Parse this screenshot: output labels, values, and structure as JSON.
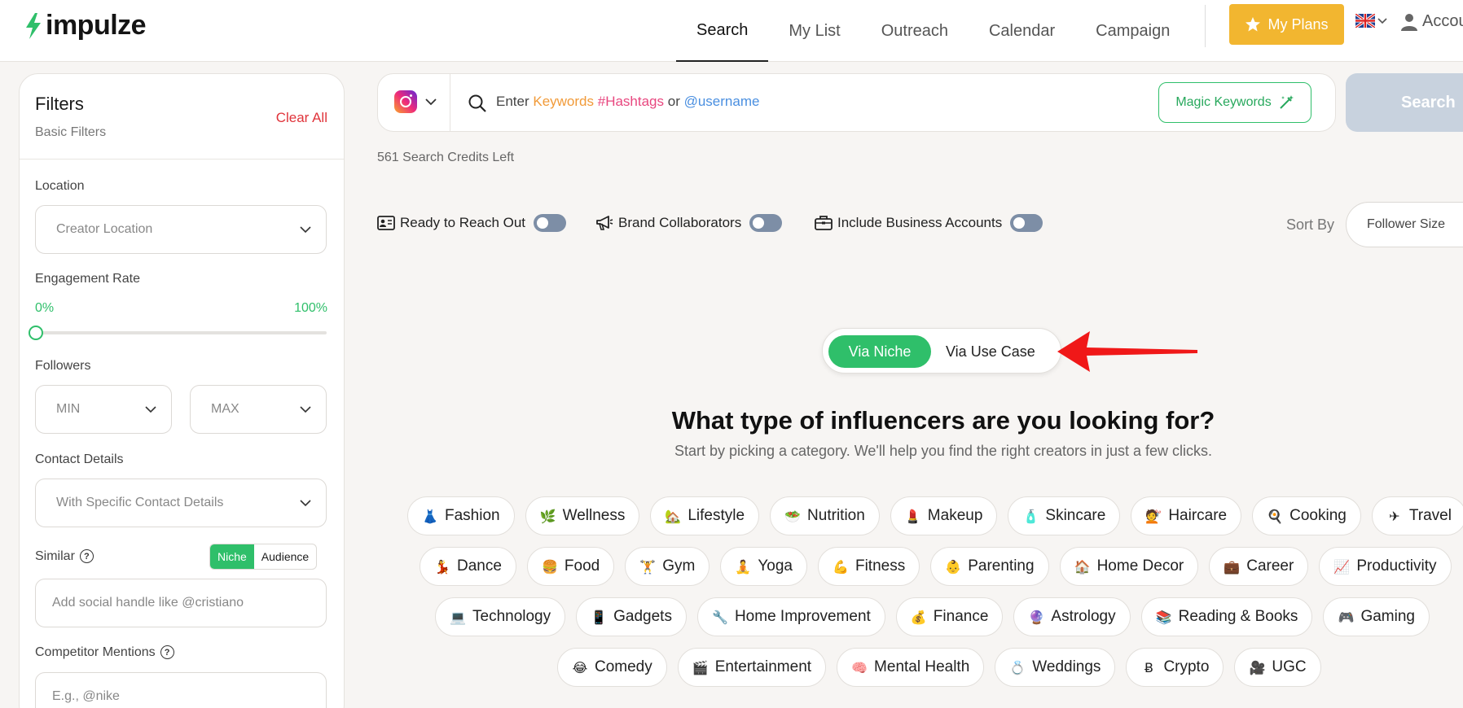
{
  "header": {
    "logo_text": "impulze",
    "nav": [
      "Search",
      "My List",
      "Outreach",
      "Calendar",
      "Campaign"
    ],
    "active_nav": "Search",
    "plans_label": "My Plans",
    "account_label": "Account"
  },
  "colors": {
    "brand_green": "#2fbf6a",
    "plans_yellow": "#f2b630",
    "clear_red": "#e0343b"
  },
  "sidebar": {
    "title": "Filters",
    "subtitle": "Basic Filters",
    "clear_all": "Clear All",
    "location_label": "Location",
    "location_placeholder": "Creator Location",
    "engagement_label": "Engagement Rate",
    "engagement_min": "0%",
    "engagement_max": "100%",
    "engagement_value": 0,
    "followers_label": "Followers",
    "followers_min": "MIN",
    "followers_max": "MAX",
    "contact_label": "Contact Details",
    "contact_placeholder": "With Specific Contact Details",
    "similar_label": "Similar",
    "similar_toggle": [
      "Niche",
      "Audience"
    ],
    "similar_active": "Niche",
    "similar_placeholder": "Add social handle like @cristiano",
    "competitor_label": "Competitor Mentions",
    "competitor_placeholder": "E.g., @nike"
  },
  "search": {
    "platform_icon": "instagram-icon",
    "placeholder_prefix": "Enter ",
    "placeholder_keywords": "Keywords",
    "placeholder_hashtags": "#Hashtags",
    "placeholder_or": " or ",
    "placeholder_username": "@username",
    "magic_label": "Magic Keywords",
    "button_label": "Search",
    "credits": "561 Search Credits Left"
  },
  "toggles": {
    "reach_out": "Ready to Reach Out",
    "brand_collab": "Brand Collaborators",
    "business": "Include Business Accounts"
  },
  "sort": {
    "label": "Sort By",
    "value": "Follower Size"
  },
  "mode": {
    "active": "Via Niche",
    "inactive": "Via Use Case"
  },
  "hero": {
    "title": "What type of influencers are you looking for?",
    "subtitle": "Start by picking a category. We'll help you find the right creators in just a few clicks."
  },
  "categories": {
    "row1": [
      {
        "emoji": "👗",
        "label": "Fashion"
      },
      {
        "emoji": "🌿",
        "label": "Wellness"
      },
      {
        "emoji": "🏡",
        "label": "Lifestyle"
      },
      {
        "emoji": "🥗",
        "label": "Nutrition"
      },
      {
        "emoji": "💄",
        "label": "Makeup"
      },
      {
        "emoji": "🧴",
        "label": "Skincare"
      },
      {
        "emoji": "💇",
        "label": "Haircare"
      },
      {
        "emoji": "🍳",
        "label": "Cooking"
      },
      {
        "emoji": "✈",
        "label": "Travel"
      }
    ],
    "row2": [
      {
        "emoji": "💃",
        "label": "Dance"
      },
      {
        "emoji": "🍔",
        "label": "Food"
      },
      {
        "emoji": "🏋",
        "label": "Gym"
      },
      {
        "emoji": "🧘",
        "label": "Yoga"
      },
      {
        "emoji": "💪",
        "label": "Fitness"
      },
      {
        "emoji": "👶",
        "label": "Parenting"
      },
      {
        "emoji": "🏠",
        "label": "Home Decor"
      },
      {
        "emoji": "💼",
        "label": "Career"
      },
      {
        "emoji": "📈",
        "label": "Productivity"
      }
    ],
    "row3": [
      {
        "emoji": "💻",
        "label": "Technology"
      },
      {
        "emoji": "📱",
        "label": "Gadgets"
      },
      {
        "emoji": "🔧",
        "label": "Home Improvement"
      },
      {
        "emoji": "💰",
        "label": "Finance"
      },
      {
        "emoji": "🔮",
        "label": "Astrology"
      },
      {
        "emoji": "📚",
        "label": "Reading & Books"
      },
      {
        "emoji": "🎮",
        "label": "Gaming"
      }
    ],
    "row4": [
      {
        "emoji": "😂",
        "label": "Comedy"
      },
      {
        "emoji": "🎬",
        "label": "Entertainment"
      },
      {
        "emoji": "🧠",
        "label": "Mental Health"
      },
      {
        "emoji": "💍",
        "label": "Weddings"
      },
      {
        "emoji": "Ƀ",
        "label": "Crypto"
      },
      {
        "emoji": "🎥",
        "label": "UGC"
      }
    ]
  }
}
